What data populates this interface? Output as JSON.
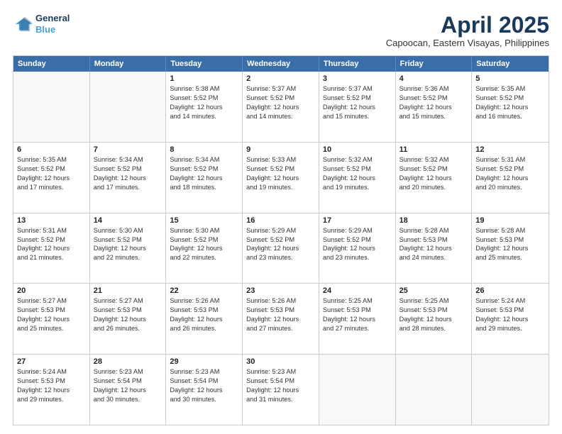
{
  "header": {
    "logo_line1": "General",
    "logo_line2": "Blue",
    "month": "April 2025",
    "location": "Capoocan, Eastern Visayas, Philippines"
  },
  "weekdays": [
    "Sunday",
    "Monday",
    "Tuesday",
    "Wednesday",
    "Thursday",
    "Friday",
    "Saturday"
  ],
  "rows": [
    [
      {
        "day": "",
        "lines": []
      },
      {
        "day": "",
        "lines": []
      },
      {
        "day": "1",
        "lines": [
          "Sunrise: 5:38 AM",
          "Sunset: 5:52 PM",
          "Daylight: 12 hours",
          "and 14 minutes."
        ]
      },
      {
        "day": "2",
        "lines": [
          "Sunrise: 5:37 AM",
          "Sunset: 5:52 PM",
          "Daylight: 12 hours",
          "and 14 minutes."
        ]
      },
      {
        "day": "3",
        "lines": [
          "Sunrise: 5:37 AM",
          "Sunset: 5:52 PM",
          "Daylight: 12 hours",
          "and 15 minutes."
        ]
      },
      {
        "day": "4",
        "lines": [
          "Sunrise: 5:36 AM",
          "Sunset: 5:52 PM",
          "Daylight: 12 hours",
          "and 15 minutes."
        ]
      },
      {
        "day": "5",
        "lines": [
          "Sunrise: 5:35 AM",
          "Sunset: 5:52 PM",
          "Daylight: 12 hours",
          "and 16 minutes."
        ]
      }
    ],
    [
      {
        "day": "6",
        "lines": [
          "Sunrise: 5:35 AM",
          "Sunset: 5:52 PM",
          "Daylight: 12 hours",
          "and 17 minutes."
        ]
      },
      {
        "day": "7",
        "lines": [
          "Sunrise: 5:34 AM",
          "Sunset: 5:52 PM",
          "Daylight: 12 hours",
          "and 17 minutes."
        ]
      },
      {
        "day": "8",
        "lines": [
          "Sunrise: 5:34 AM",
          "Sunset: 5:52 PM",
          "Daylight: 12 hours",
          "and 18 minutes."
        ]
      },
      {
        "day": "9",
        "lines": [
          "Sunrise: 5:33 AM",
          "Sunset: 5:52 PM",
          "Daylight: 12 hours",
          "and 19 minutes."
        ]
      },
      {
        "day": "10",
        "lines": [
          "Sunrise: 5:32 AM",
          "Sunset: 5:52 PM",
          "Daylight: 12 hours",
          "and 19 minutes."
        ]
      },
      {
        "day": "11",
        "lines": [
          "Sunrise: 5:32 AM",
          "Sunset: 5:52 PM",
          "Daylight: 12 hours",
          "and 20 minutes."
        ]
      },
      {
        "day": "12",
        "lines": [
          "Sunrise: 5:31 AM",
          "Sunset: 5:52 PM",
          "Daylight: 12 hours",
          "and 20 minutes."
        ]
      }
    ],
    [
      {
        "day": "13",
        "lines": [
          "Sunrise: 5:31 AM",
          "Sunset: 5:52 PM",
          "Daylight: 12 hours",
          "and 21 minutes."
        ]
      },
      {
        "day": "14",
        "lines": [
          "Sunrise: 5:30 AM",
          "Sunset: 5:52 PM",
          "Daylight: 12 hours",
          "and 22 minutes."
        ]
      },
      {
        "day": "15",
        "lines": [
          "Sunrise: 5:30 AM",
          "Sunset: 5:52 PM",
          "Daylight: 12 hours",
          "and 22 minutes."
        ]
      },
      {
        "day": "16",
        "lines": [
          "Sunrise: 5:29 AM",
          "Sunset: 5:52 PM",
          "Daylight: 12 hours",
          "and 23 minutes."
        ]
      },
      {
        "day": "17",
        "lines": [
          "Sunrise: 5:29 AM",
          "Sunset: 5:52 PM",
          "Daylight: 12 hours",
          "and 23 minutes."
        ]
      },
      {
        "day": "18",
        "lines": [
          "Sunrise: 5:28 AM",
          "Sunset: 5:53 PM",
          "Daylight: 12 hours",
          "and 24 minutes."
        ]
      },
      {
        "day": "19",
        "lines": [
          "Sunrise: 5:28 AM",
          "Sunset: 5:53 PM",
          "Daylight: 12 hours",
          "and 25 minutes."
        ]
      }
    ],
    [
      {
        "day": "20",
        "lines": [
          "Sunrise: 5:27 AM",
          "Sunset: 5:53 PM",
          "Daylight: 12 hours",
          "and 25 minutes."
        ]
      },
      {
        "day": "21",
        "lines": [
          "Sunrise: 5:27 AM",
          "Sunset: 5:53 PM",
          "Daylight: 12 hours",
          "and 26 minutes."
        ]
      },
      {
        "day": "22",
        "lines": [
          "Sunrise: 5:26 AM",
          "Sunset: 5:53 PM",
          "Daylight: 12 hours",
          "and 26 minutes."
        ]
      },
      {
        "day": "23",
        "lines": [
          "Sunrise: 5:26 AM",
          "Sunset: 5:53 PM",
          "Daylight: 12 hours",
          "and 27 minutes."
        ]
      },
      {
        "day": "24",
        "lines": [
          "Sunrise: 5:25 AM",
          "Sunset: 5:53 PM",
          "Daylight: 12 hours",
          "and 27 minutes."
        ]
      },
      {
        "day": "25",
        "lines": [
          "Sunrise: 5:25 AM",
          "Sunset: 5:53 PM",
          "Daylight: 12 hours",
          "and 28 minutes."
        ]
      },
      {
        "day": "26",
        "lines": [
          "Sunrise: 5:24 AM",
          "Sunset: 5:53 PM",
          "Daylight: 12 hours",
          "and 29 minutes."
        ]
      }
    ],
    [
      {
        "day": "27",
        "lines": [
          "Sunrise: 5:24 AM",
          "Sunset: 5:53 PM",
          "Daylight: 12 hours",
          "and 29 minutes."
        ]
      },
      {
        "day": "28",
        "lines": [
          "Sunrise: 5:23 AM",
          "Sunset: 5:54 PM",
          "Daylight: 12 hours",
          "and 30 minutes."
        ]
      },
      {
        "day": "29",
        "lines": [
          "Sunrise: 5:23 AM",
          "Sunset: 5:54 PM",
          "Daylight: 12 hours",
          "and 30 minutes."
        ]
      },
      {
        "day": "30",
        "lines": [
          "Sunrise: 5:23 AM",
          "Sunset: 5:54 PM",
          "Daylight: 12 hours",
          "and 31 minutes."
        ]
      },
      {
        "day": "",
        "lines": []
      },
      {
        "day": "",
        "lines": []
      },
      {
        "day": "",
        "lines": []
      }
    ]
  ]
}
